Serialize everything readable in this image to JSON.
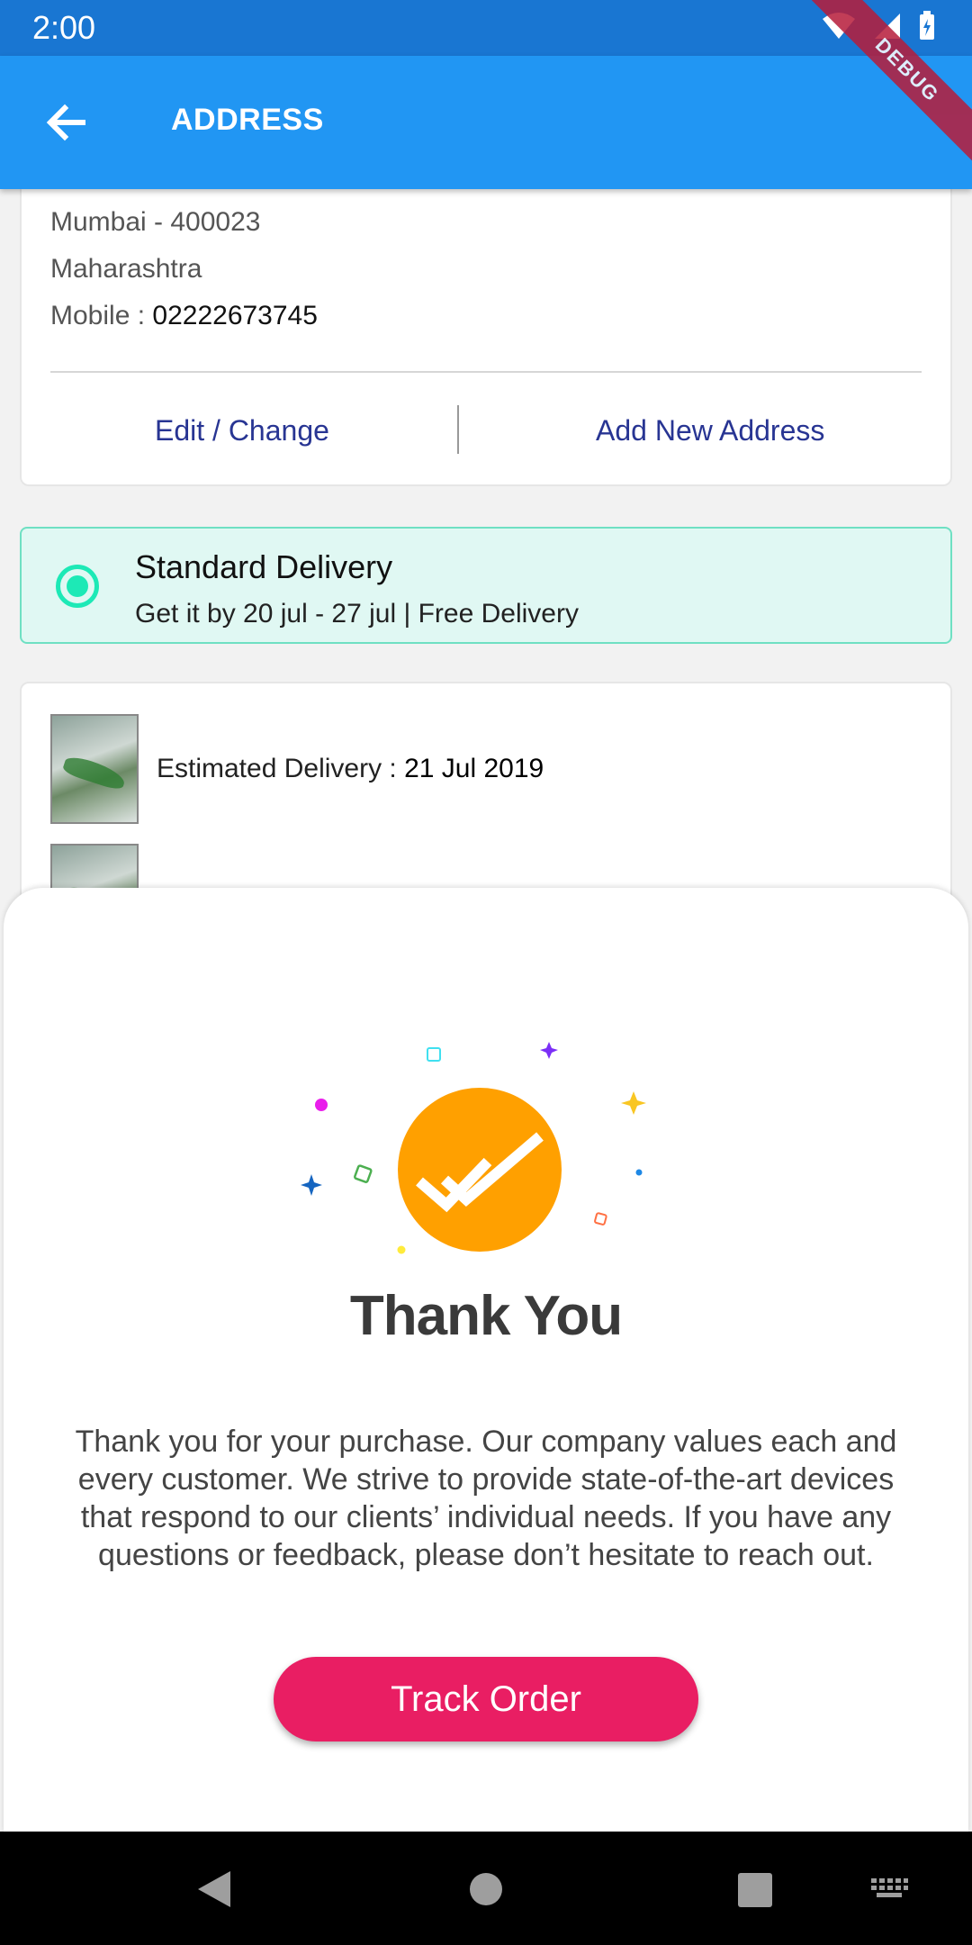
{
  "status_bar": {
    "time": "2:00"
  },
  "app_bar": {
    "title": "ADDRESS",
    "debug_label": "DEBUG"
  },
  "address": {
    "city_pin": "Mumbai - 400023",
    "state": "Maharashtra",
    "mobile_label": "Mobile : ",
    "mobile": "02222673745",
    "edit_label": "Edit / Change",
    "add_label": "Add New Address"
  },
  "delivery": {
    "title": "Standard Delivery",
    "subtitle": "Get it by 20 jul - 27 jul | Free Delivery",
    "selected": true
  },
  "products": {
    "estimated_label": "Estimated Delivery : ",
    "estimated_date": "21 Jul 2019"
  },
  "thank_you": {
    "title": "Thank You",
    "message": "Thank you for your purchase. Our company values each and every customer. We strive to provide state-of-the-art devices that respond to our clients’ individual needs. If you have any questions or feedback, please don’t hesitate to reach out.",
    "button_label": "Track Order"
  },
  "colors": {
    "app_bar": "#2196f3",
    "status_bar": "#1976d2",
    "accent_link": "#283593",
    "delivery_bg": "#e0f8f3",
    "radio": "#1de9b6",
    "check_circle": "#ffa000",
    "track_button": "#e91e63"
  }
}
